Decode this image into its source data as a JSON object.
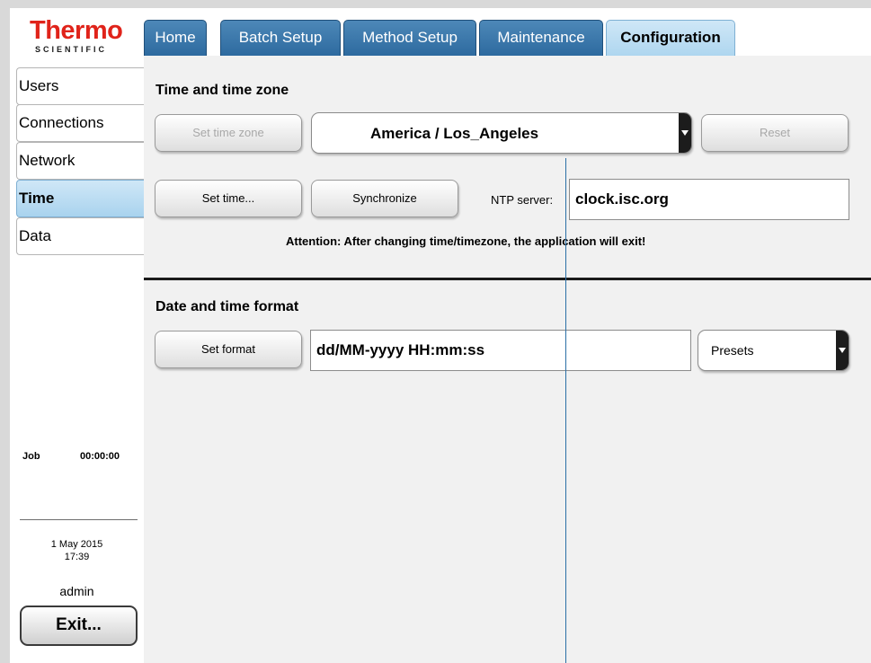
{
  "logo": {
    "brand": "Thermo",
    "sub": "SCIENTIFIC"
  },
  "tabs": [
    "Home",
    "Batch Setup",
    "Method Setup",
    "Maintenance",
    "Configuration"
  ],
  "active_tab": "Configuration",
  "sidebar": {
    "items": [
      "Users",
      "Connections",
      "Network",
      "Time",
      "Data"
    ],
    "active": "Time",
    "job_label": "Job",
    "job_time": "00:00:00",
    "date": "1 May 2015",
    "time": "17:39",
    "user": "admin",
    "exit_label": "Exit..."
  },
  "time_section": {
    "title": "Time and time zone",
    "set_time_zone_label": "Set time zone",
    "time_zone_value": "America / Los_Angeles",
    "reset_label": "Reset",
    "set_time_label": "Set time...",
    "synchronize_label": "Synchronize",
    "ntp_label": "NTP server:",
    "ntp_value": "clock.isc.org",
    "attention": "Attention: After changing time/timezone, the application will exit!"
  },
  "format_section": {
    "title": "Date and time format",
    "set_format_label": "Set format",
    "format_value": "dd/MM-yyyy HH:mm:ss",
    "presets_label": "Presets"
  },
  "colors": {
    "tab_blue": "#2d6a9f",
    "active_tab_bg": "#aed6ef",
    "brand_red": "#e0231a"
  }
}
